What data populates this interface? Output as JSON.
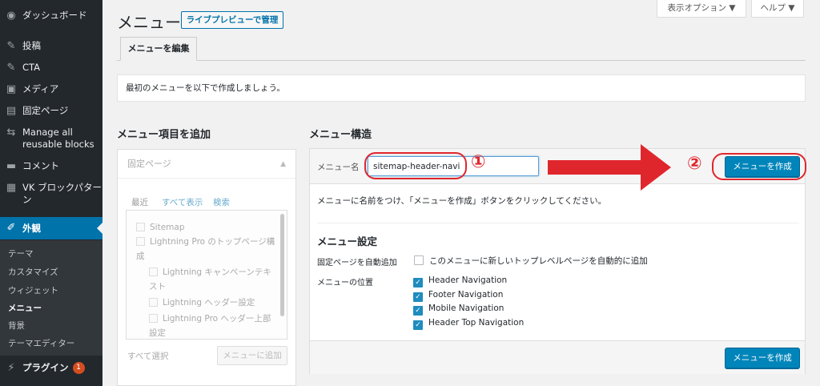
{
  "sidebar": {
    "items": [
      {
        "label": "ダッシュボード",
        "icon": "dashboard-icon"
      },
      {
        "label": "投稿",
        "icon": "pin-icon"
      },
      {
        "label": "CTA",
        "icon": "pin-icon"
      },
      {
        "label": "メディア",
        "icon": "media-icon"
      },
      {
        "label": "固定ページ",
        "icon": "page-icon"
      },
      {
        "label": "Manage all reusable blocks",
        "icon": "blocks-icon"
      },
      {
        "label": "コメント",
        "icon": "comment-icon"
      },
      {
        "label": "VK ブロックパターン",
        "icon": "grid-icon"
      },
      {
        "label": "外観",
        "icon": "brush-icon"
      }
    ],
    "submenu": [
      "テーマ",
      "カスタマイズ",
      "ウィジェット",
      "メニュー",
      "背景",
      "テーマエディター"
    ],
    "plugins_label": "プラグイン",
    "plugins_badge": "1"
  },
  "header": {
    "title": "メニュー",
    "live_preview": "ライブプレビューで管理",
    "screen_options": "表示オプション ▼",
    "help": "ヘルプ ▼",
    "tab_edit": "メニューを編集"
  },
  "notice": "最初のメニューを以下で作成しましょう。",
  "left": {
    "heading": "メニュー項目を追加",
    "accordion_title": "固定ページ",
    "tabs": [
      "最近",
      "すべて表示",
      "検索"
    ],
    "pages": [
      "Sitemap",
      "Lightning Pro のトップページ構成",
      "Lightning キャンペーンテキスト",
      "Lightning ヘッダー設定",
      "Lightning Pro ヘッダー上部設定"
    ],
    "select_all": "すべて選択",
    "add_button": "メニューに追加"
  },
  "right": {
    "heading": "メニュー構造",
    "menu_name_label": "メニュー名",
    "menu_name_value": "sitemap-header-navi",
    "create_button": "メニューを作成",
    "instruction": "メニューに名前をつけ、「メニューを作成」ボタンをクリックしてください。",
    "settings_heading": "メニュー設定",
    "auto_add_label": "固定ページを自動追加",
    "auto_add_text": "このメニューに新しいトップレベルページを自動的に追加",
    "locations_label": "メニューの位置",
    "locations": [
      "Header Navigation",
      "Footer Navigation",
      "Mobile Navigation",
      "Header Top Navigation"
    ]
  },
  "annotations": {
    "step1": "①",
    "step2": "②",
    "color": "#e0262d"
  },
  "colors": {
    "accent": "#0073aa",
    "button": "#0085ba",
    "sidebar": "#23282d"
  }
}
